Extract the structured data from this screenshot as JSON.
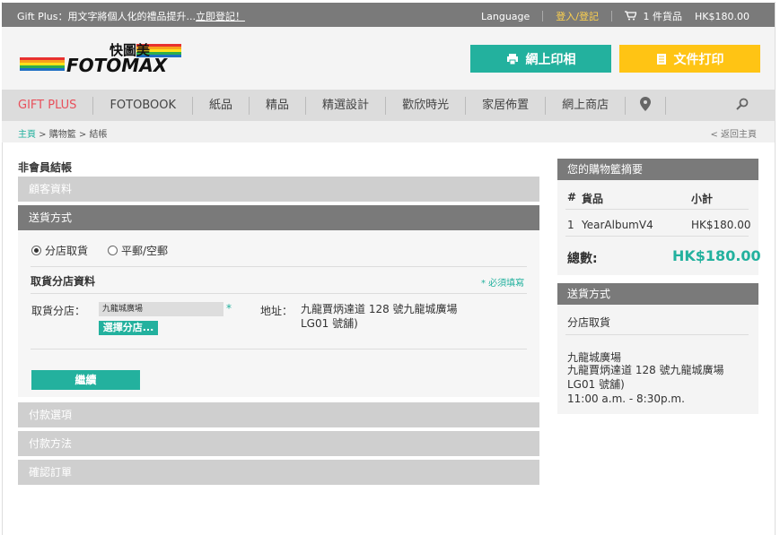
{
  "topbar": {
    "promo_prefix": "Gift Plus：用文字將個人化的禮品提升...",
    "promo_link": "立即登記！",
    "language": "Language",
    "login": "登入/登記",
    "cart": "1 件貨品",
    "cart_total": "HK$180.00"
  },
  "header": {
    "photo_btn": "網上印相",
    "doc_btn": "文件打印"
  },
  "nav": {
    "items": [
      "GIFT PLUS",
      "FOTOBOOK",
      "紙品",
      "精品",
      "精選設計",
      "歡欣時光",
      "家居佈置",
      "網上商店"
    ]
  },
  "breadcrumb": {
    "home": "主頁",
    "cart": "購物籃",
    "checkout": "結帳",
    "back": "< 返回主頁"
  },
  "checkout": {
    "title": "非會員結帳",
    "customer": "顧客資料",
    "shipping": "送貨方式",
    "option1": "分店取貨",
    "option2": "平郵/空郵",
    "store_title": "取貨分店資料",
    "required": "* 必須填寫",
    "store_label": "取貨分店：",
    "store_value": "九龍城廣場",
    "select_store": "選擇分店...",
    "address_label": "地址：",
    "address": "九龍賈炳達道 128 號九龍城廣場 LG01 號舖)",
    "continue": "繼續",
    "payment_option": "付款選項",
    "payment_method": "付款方法",
    "confirm": "確認訂單"
  },
  "summary": {
    "title": "您的購物籃摘要",
    "col_no": "#",
    "col_item": "貨品",
    "col_sub": "小計",
    "row_no": "1",
    "row_item": "YearAlbumV4",
    "row_sub": "HK$180.00",
    "total_label": "總數:",
    "total_value": "HK$180.00"
  },
  "shipping_side": {
    "title": "送貨方式",
    "method": "分店取貨",
    "store": "九龍城廣場",
    "address": "九龍賈炳達道 128 號九龍城廣場 LG01 號舖)",
    "hours": "11:00 a.m. - 8:30p.m."
  },
  "colors": {
    "accent": "#23b19e",
    "yellow": "#ffc414",
    "pink": "#e8505b"
  }
}
